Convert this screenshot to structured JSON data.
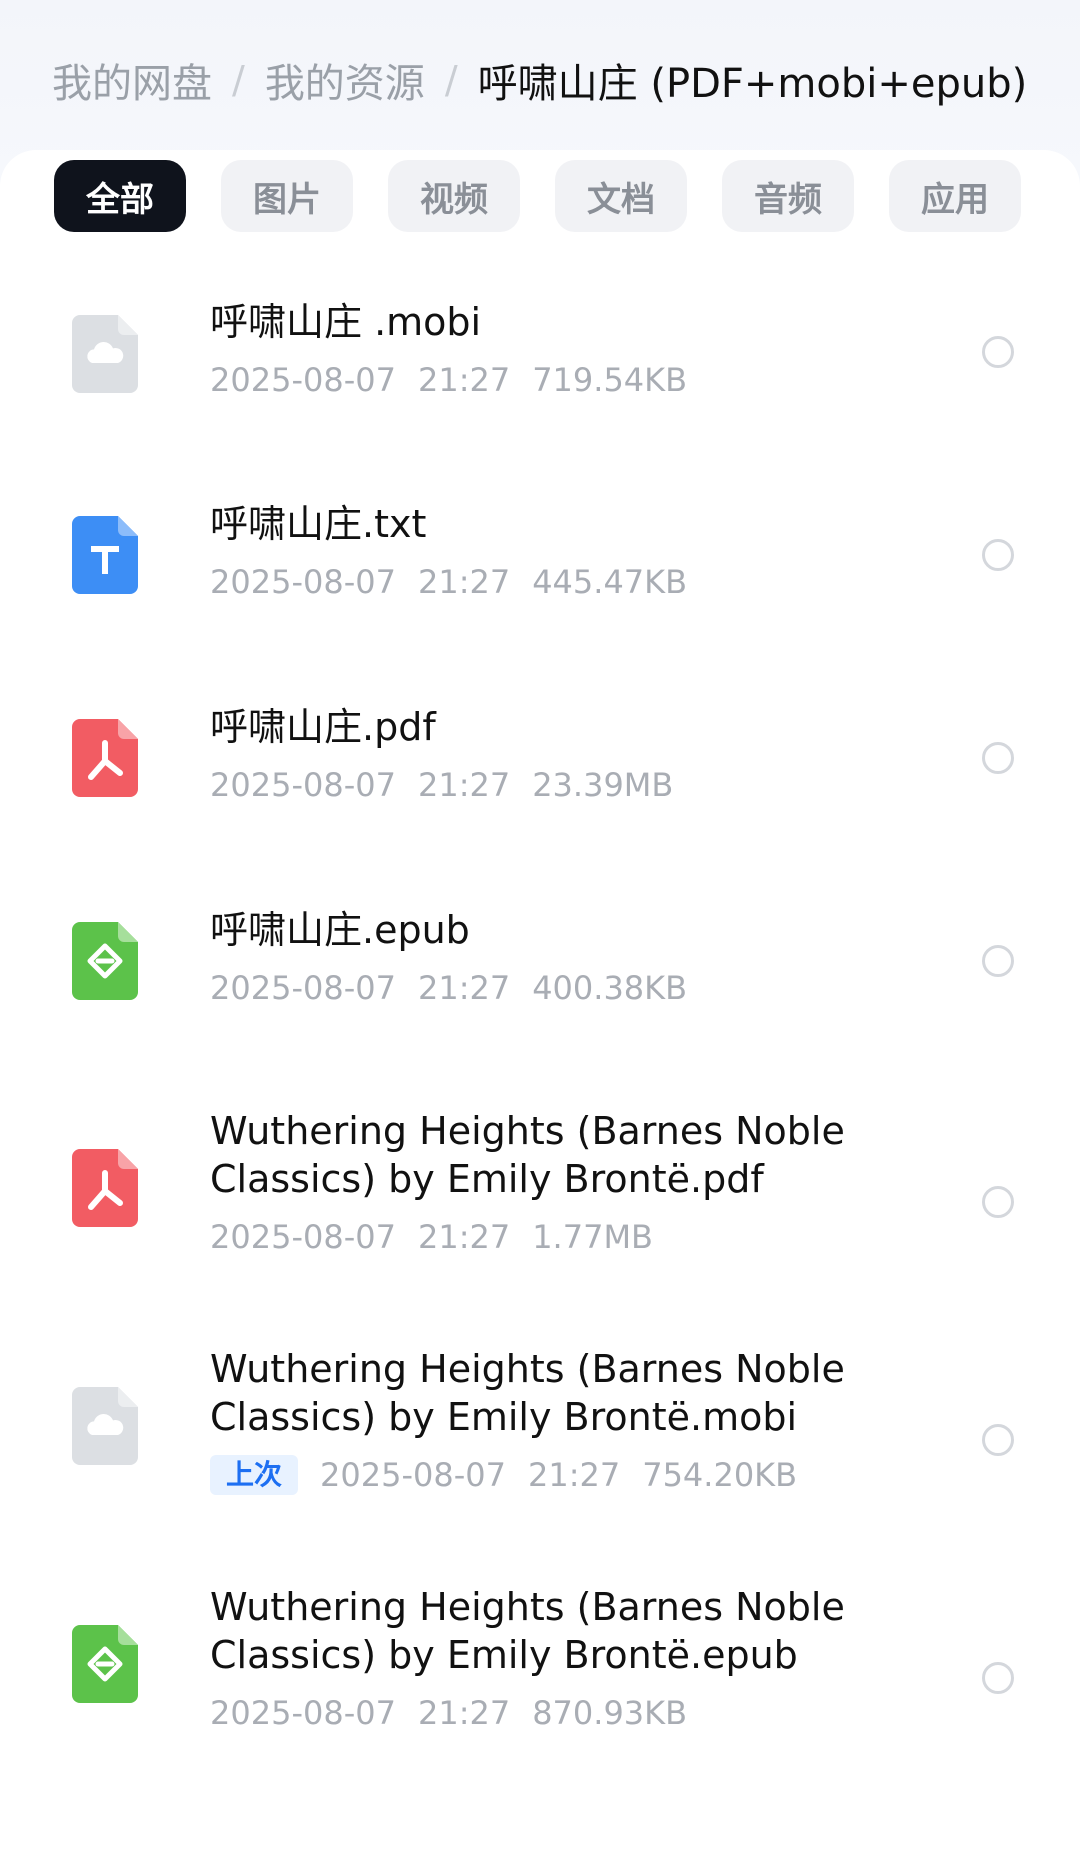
{
  "breadcrumb": {
    "items": [
      "我的网盘",
      "我的资源"
    ],
    "separator": "/",
    "current": "呼啸山庄 (PDF+mobi+epub)"
  },
  "tabs": [
    {
      "label": "全部",
      "active": true
    },
    {
      "label": "图片",
      "active": false
    },
    {
      "label": "视频",
      "active": false
    },
    {
      "label": "文档",
      "active": false
    },
    {
      "label": "音频",
      "active": false
    },
    {
      "label": "应用",
      "active": false
    }
  ],
  "files": [
    {
      "name": "呼啸山庄 .mobi",
      "date": "2025-08-07",
      "time": "21:27",
      "size": "719.54KB",
      "icon": "cloud-file-icon",
      "badge": ""
    },
    {
      "name": "呼啸山庄.txt",
      "date": "2025-08-07",
      "time": "21:27",
      "size": "445.47KB",
      "icon": "txt-file-icon",
      "badge": ""
    },
    {
      "name": "呼啸山庄.pdf",
      "date": "2025-08-07",
      "time": "21:27",
      "size": "23.39MB",
      "icon": "pdf-file-icon",
      "badge": ""
    },
    {
      "name": "呼啸山庄.epub",
      "date": "2025-08-07",
      "time": "21:27",
      "size": "400.38KB",
      "icon": "epub-file-icon",
      "badge": ""
    },
    {
      "name": "Wuthering Heights (Barnes  Noble Classics) by Emily Brontë.pdf",
      "date": "2025-08-07",
      "time": "21:27",
      "size": "1.77MB",
      "icon": "pdf-file-icon",
      "badge": ""
    },
    {
      "name": "Wuthering Heights (Barnes  Noble Classics) by Emily Brontë.mobi",
      "date": "2025-08-07",
      "time": "21:27",
      "size": "754.20KB",
      "icon": "cloud-file-icon",
      "badge": "上次"
    },
    {
      "name": "Wuthering Heights (Barnes  Noble Classics) by Emily Brontë.epub",
      "date": "2025-08-07",
      "time": "21:27",
      "size": "870.93KB",
      "icon": "epub-file-icon",
      "badge": ""
    }
  ],
  "colors": {
    "active_tab": "#0f131c",
    "badge_text": "#1d6ff2",
    "pdf": "#f25c63",
    "txt": "#3d8ef5",
    "epub": "#5cc24a",
    "cloud": "#d9dce0"
  }
}
